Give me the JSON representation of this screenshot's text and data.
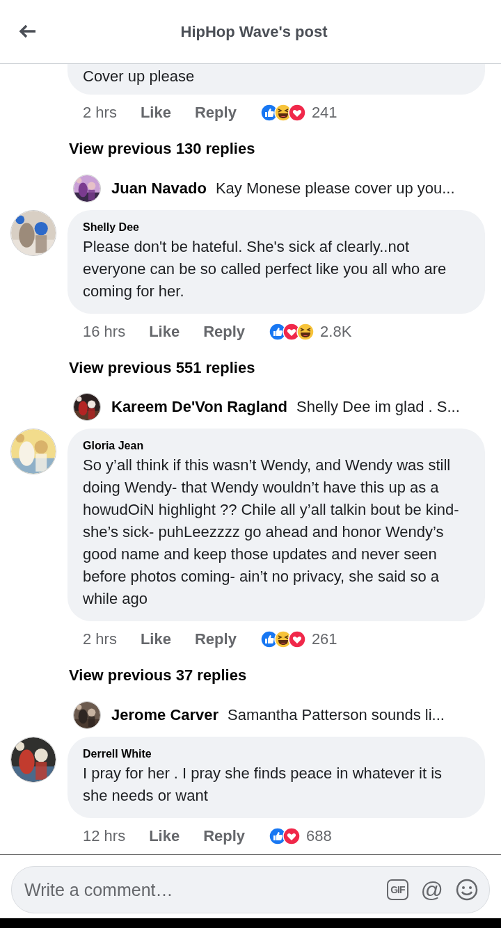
{
  "header": {
    "title": "HipHop Wave's post"
  },
  "items": [
    {
      "kind": "cut_comment",
      "text": "Cover up please",
      "time": "2 hrs",
      "like": "Like",
      "reply": "Reply",
      "reactions": [
        {
          "kind": "like"
        },
        {
          "kind": "haha"
        },
        {
          "kind": "love"
        }
      ],
      "count": "241"
    },
    {
      "kind": "more",
      "text": "View previous 130 replies"
    },
    {
      "kind": "preview",
      "name": "Juan Navado",
      "text": "Kay Monese please cover up you..."
    },
    {
      "kind": "comment",
      "name": "Shelly Dee",
      "text": "Please don't be hateful. She's sick af clearly..not everyone can be so called perfect like you all who are coming for her.",
      "time": "16 hrs",
      "like": "Like",
      "reply": "Reply",
      "reactions": [
        {
          "kind": "like"
        },
        {
          "kind": "love"
        },
        {
          "kind": "haha"
        }
      ],
      "count": "2.8K"
    },
    {
      "kind": "more",
      "text": "View previous 551 replies"
    },
    {
      "kind": "preview",
      "name": "Kareem De'Von Ragland",
      "text": "Shelly Dee im glad . S..."
    },
    {
      "kind": "comment",
      "name": "Gloria Jean",
      "text": "So y’all think if this wasn’t Wendy, and Wendy was still doing Wendy- that Wendy wouldn’t have this up as a howudOiN highlight ?? Chile all y’all talkin bout be kind- she’s sick- puhLeezzzz go ahead and honor Wendy’s good name and keep those updates and never seen before photos coming- ain’t no privacy, she said so a while ago",
      "time": "2 hrs",
      "like": "Like",
      "reply": "Reply",
      "reactions": [
        {
          "kind": "like"
        },
        {
          "kind": "haha"
        },
        {
          "kind": "love"
        }
      ],
      "count": "261"
    },
    {
      "kind": "more",
      "text": "View previous 37 replies"
    },
    {
      "kind": "preview",
      "name": "Jerome Carver",
      "text": "Samantha Patterson sounds li..."
    },
    {
      "kind": "comment",
      "name": "Derrell White",
      "text": "I pray for her . I pray she finds peace in whatever it is she needs or want",
      "time": "12 hrs",
      "like": "Like",
      "reply": "Reply",
      "reactions": [
        {
          "kind": "like"
        },
        {
          "kind": "love"
        }
      ],
      "count": "688"
    }
  ],
  "composer": {
    "placeholder": "Write a comment…",
    "gif": "GIF",
    "mention": "@"
  }
}
